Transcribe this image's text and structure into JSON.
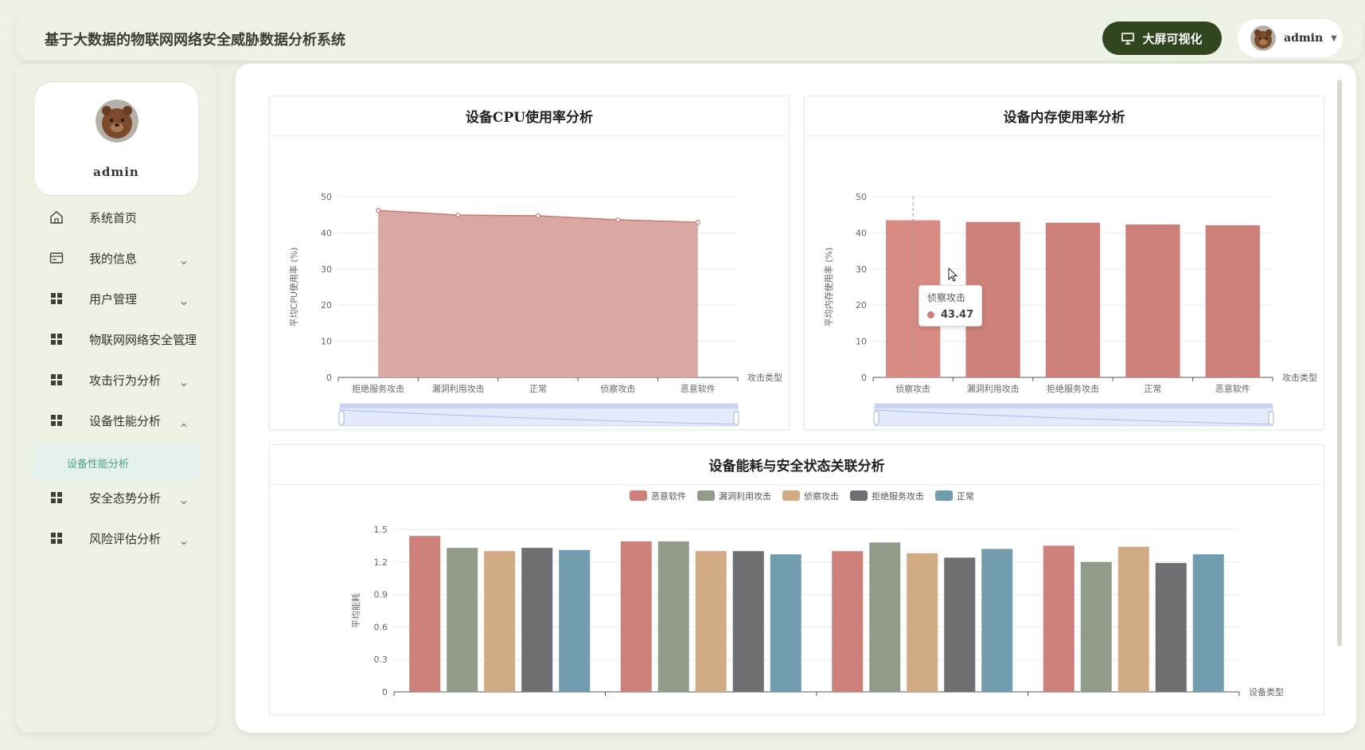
{
  "app": {
    "title": "基于大数据的物联网网络安全威胁数据分析系统"
  },
  "header": {
    "big_screen_label": "大屏可视化",
    "user_name": "admin"
  },
  "sidebar": {
    "profile_name": "admin",
    "items": [
      {
        "label": "系统首页",
        "icon": "home-icon",
        "expanded": null
      },
      {
        "label": "我的信息",
        "icon": "id-card-icon",
        "expanded": false
      },
      {
        "label": "用户管理",
        "icon": "grid-icon",
        "expanded": false
      },
      {
        "label": "物联网网络安全管理",
        "icon": "grid-icon",
        "expanded": false
      },
      {
        "label": "攻击行为分析",
        "icon": "grid-icon",
        "expanded": false
      },
      {
        "label": "设备性能分析",
        "icon": "grid-icon",
        "expanded": true
      },
      {
        "label": "安全态势分析",
        "icon": "grid-icon",
        "expanded": false
      },
      {
        "label": "风险评估分析",
        "icon": "grid-icon",
        "expanded": false
      }
    ],
    "active_sub": {
      "label": "设备性能分析"
    }
  },
  "cards": {
    "cpu_title": "设备CPU使用率分析",
    "mem_title": "设备内存使用率分析",
    "energy_title": "设备能耗与安全状态关联分析"
  },
  "tooltip": {
    "title": "侦察攻击",
    "value": "43.47"
  },
  "colors": {
    "area": "#cd8079",
    "accent": "#31451f"
  },
  "chart_data": [
    {
      "type": "area",
      "title": "设备CPU使用率分析",
      "categories": [
        "拒绝服务攻击",
        "漏洞利用攻击",
        "正常",
        "侦察攻击",
        "恶意软件"
      ],
      "values": [
        46.2,
        44.9,
        44.7,
        43.6,
        42.9
      ],
      "xlabel": "攻击类型",
      "ylabel": "平均CPU使用率 (%)",
      "ylim": [
        0,
        50
      ],
      "yticks": [
        "0",
        "10",
        "20",
        "30",
        "40",
        "50"
      ],
      "grid": true
    },
    {
      "type": "bar",
      "title": "设备内存使用率分析",
      "categories": [
        "侦察攻击",
        "漏洞利用攻击",
        "拒绝服务攻击",
        "正常",
        "恶意软件"
      ],
      "values": [
        43.47,
        43.0,
        42.8,
        42.3,
        42.1
      ],
      "xlabel": "攻击类型",
      "ylabel": "平均内存使用率 (%)",
      "ylim": [
        0,
        50
      ],
      "yticks": [
        "0",
        "10",
        "20",
        "30",
        "40",
        "50"
      ],
      "grid": true
    },
    {
      "type": "bar",
      "title": "设备能耗与安全状态关联分析",
      "groups": 4,
      "series": [
        {
          "name": "恶意软件",
          "color": "#cd8079",
          "values": [
            1.44,
            1.39,
            1.3,
            1.35
          ]
        },
        {
          "name": "漏洞利用攻击",
          "color": "#939c8a",
          "values": [
            1.33,
            1.39,
            1.38,
            1.2
          ]
        },
        {
          "name": "侦察攻击",
          "color": "#d0ab83",
          "values": [
            1.3,
            1.3,
            1.28,
            1.34
          ]
        },
        {
          "name": "拒绝服务攻击",
          "color": "#6e6f73",
          "values": [
            1.33,
            1.3,
            1.24,
            1.19
          ]
        },
        {
          "name": "正常",
          "color": "#729dae",
          "values": [
            1.31,
            1.27,
            1.32,
            1.27
          ]
        }
      ],
      "xlabel": "设备类型",
      "ylabel": "平均能耗",
      "ylim": [
        0,
        1.5
      ],
      "yticks": [
        "0",
        "0.3",
        "0.6",
        "0.9",
        "1.2",
        "1.5"
      ],
      "legend": "top",
      "grid": true
    }
  ]
}
